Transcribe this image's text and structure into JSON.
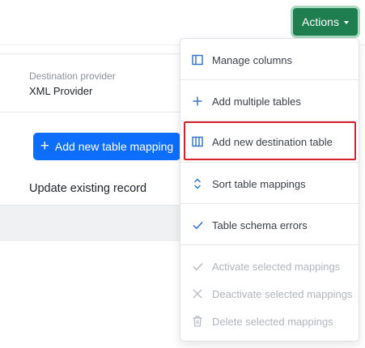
{
  "header": {
    "actions_label": "Actions"
  },
  "provider": {
    "label": "Destination provider",
    "value": "XML Provider"
  },
  "mapping": {
    "add_button_label": "Add new table mapping",
    "update_text": "Update existing record"
  },
  "menu": {
    "items": [
      {
        "label": "Manage columns",
        "icon": "columns-icon",
        "enabled": true
      },
      {
        "label": "Add multiple tables",
        "icon": "plus-icon",
        "enabled": true
      },
      {
        "label": "Add new destination table",
        "icon": "columns-icon",
        "enabled": true,
        "highlighted": true
      },
      {
        "label": "Sort table mappings",
        "icon": "sort-icon",
        "enabled": true
      },
      {
        "label": "Table schema errors",
        "icon": "check-icon",
        "enabled": true
      },
      {
        "label": "Activate selected mappings",
        "icon": "check-icon",
        "enabled": false
      },
      {
        "label": "Deactivate selected mappings",
        "icon": "close-icon",
        "enabled": false
      },
      {
        "label": "Delete selected mappings",
        "icon": "trash-icon",
        "enabled": false
      }
    ]
  },
  "colors": {
    "actions_bg": "#1e7e4f",
    "primary_bg": "#0d6efd",
    "icon": "#2d6fc6",
    "highlight_border": "#d6212b"
  }
}
